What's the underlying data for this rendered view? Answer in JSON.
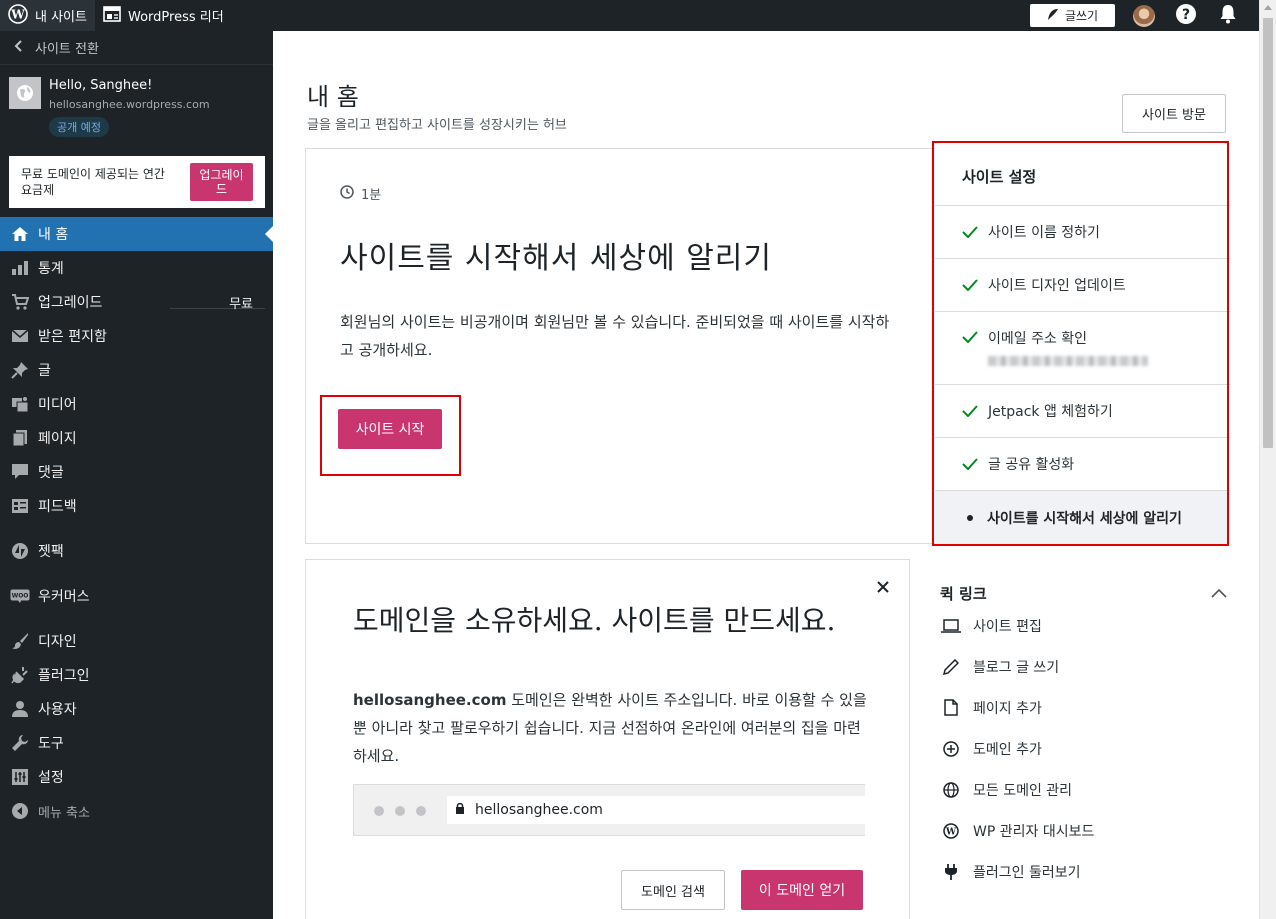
{
  "topbar": {
    "my_site": "내 사이트",
    "reader": "WordPress 리더",
    "write": "글쓰기"
  },
  "sidebar": {
    "switch_site": "사이트 전환",
    "site_name": "Hello, Sanghee!",
    "site_url": "hellosanghee.wordpress.com",
    "site_status": "공개 예정",
    "upgrade_text": "무료 도메인이 제공되는 연간 요금제",
    "upgrade_button": "업그레이드",
    "menu": [
      {
        "label": "내 홈",
        "icon": "home-icon",
        "active": true
      },
      {
        "label": "통계",
        "icon": "stats-icon"
      },
      {
        "label": "업그레이드",
        "icon": "cart-icon",
        "right": "무료"
      },
      {
        "label": "받은 편지함",
        "icon": "mail-icon"
      },
      {
        "label": "글",
        "icon": "pin-icon"
      },
      {
        "label": "미디어",
        "icon": "media-icon"
      },
      {
        "label": "페이지",
        "icon": "pages-icon"
      },
      {
        "label": "댓글",
        "icon": "comment-icon"
      },
      {
        "label": "피드백",
        "icon": "feedback-icon"
      },
      {
        "label": "젯팩",
        "icon": "jetpack-icon"
      },
      {
        "label": "우커머스",
        "icon": "woo-icon"
      },
      {
        "label": "디자인",
        "icon": "brush-icon"
      },
      {
        "label": "플러그인",
        "icon": "plugin-icon"
      },
      {
        "label": "사용자",
        "icon": "user-icon"
      },
      {
        "label": "도구",
        "icon": "wrench-icon"
      },
      {
        "label": "설정",
        "icon": "settings-icon"
      },
      {
        "label": "메뉴 축소",
        "icon": "collapse-icon"
      }
    ]
  },
  "main": {
    "title": "내 홈",
    "subtitle": "글을 올리고 편집하고 사이트를 성장시키는 허브",
    "visit_button": "사이트 방문",
    "task": {
      "duration": "1분",
      "title": "사이트를 시작해서 세상에 알리기",
      "description": "회원님의 사이트는 비공개이며 회원님만 볼 수 있습니다. 준비되었을 때 사이트를 시작하고 공개하세요.",
      "button": "사이트 시작"
    },
    "checklist": {
      "title": "사이트 설정",
      "items": [
        {
          "label": "사이트 이름 정하기",
          "done": true
        },
        {
          "label": "사이트 디자인 업데이트",
          "done": true
        },
        {
          "label": "이메일 주소 확인",
          "done": true
        },
        {
          "label": "Jetpack 앱 체험하기",
          "done": true
        },
        {
          "label": "글 공유 활성화",
          "done": true
        },
        {
          "label": "사이트를 시작해서 세상에 알리기",
          "done": false
        }
      ]
    },
    "domain": {
      "title": "도메인을 소유하세요. 사이트를 만드세요.",
      "domain_name": "hellosanghee.com",
      "description": " 도메인은 완벽한 사이트 주소입니다. 바로 이용할 수 있을 뿐 아니라 찾고 팔로우하기 쉽습니다. 지금 선점하여 온라인에 여러분의 집을 마련하세요.",
      "url": "hellosanghee.com",
      "search_button": "도메인 검색",
      "open_button": "이 도메인 얻기"
    },
    "quick_links": {
      "title": "퀵 링크",
      "items": [
        {
          "label": "사이트 편집",
          "icon": "laptop-icon"
        },
        {
          "label": "블로그 글 쓰기",
          "icon": "pencil-icon"
        },
        {
          "label": "페이지 추가",
          "icon": "page-icon"
        },
        {
          "label": "도메인 추가",
          "icon": "plus-circle-icon"
        },
        {
          "label": "모든 도메인 관리",
          "icon": "globe-icon"
        },
        {
          "label": "WP 관리자 대시보드",
          "icon": "wordpress-icon"
        },
        {
          "label": "플러그인 둘러보기",
          "icon": "plug-icon"
        }
      ]
    }
  }
}
